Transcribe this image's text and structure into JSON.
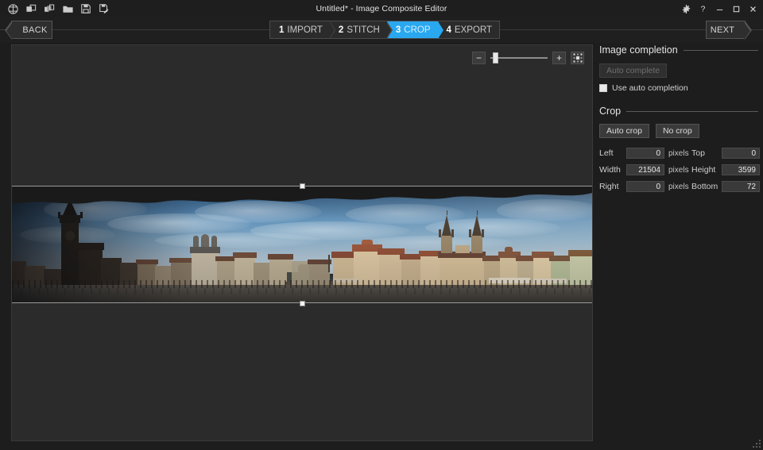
{
  "titlebar": {
    "title": "Untitled* - Image Composite Editor",
    "tools": [
      {
        "name": "new-panorama-icon",
        "label": "New panorama"
      },
      {
        "name": "new-from-images-icon",
        "label": "New panorama from images"
      },
      {
        "name": "new-from-video-icon",
        "label": "New panorama from video"
      },
      {
        "name": "open-icon",
        "label": "Open"
      },
      {
        "name": "save-icon",
        "label": "Save"
      },
      {
        "name": "save-as-icon",
        "label": "Save as"
      }
    ],
    "controls": [
      {
        "name": "settings-icon",
        "label": "Settings"
      },
      {
        "name": "help-icon",
        "label": "Help"
      },
      {
        "name": "minimize-button",
        "label": "Minimize"
      },
      {
        "name": "maximize-button",
        "label": "Maximize"
      },
      {
        "name": "close-button",
        "label": "Close"
      }
    ]
  },
  "nav": {
    "back_label": "BACK",
    "next_label": "NEXT",
    "steps": [
      {
        "num": "1",
        "label": "IMPORT",
        "active": false
      },
      {
        "num": "2",
        "label": "STITCH",
        "active": false
      },
      {
        "num": "3",
        "label": "CROP",
        "active": true
      },
      {
        "num": "4",
        "label": "EXPORT",
        "active": false
      }
    ],
    "active_color": "#29a8f0"
  },
  "zoom_toolbar": {
    "zoom_out_label": "−",
    "zoom_in_label": "+",
    "fit_label": "Fit to window",
    "slider_position_percent": 5
  },
  "panel": {
    "image_completion": {
      "heading": "Image completion",
      "auto_complete_label": "Auto complete",
      "auto_complete_enabled": false,
      "use_auto_completion_label": "Use auto completion",
      "use_auto_completion_checked": false
    },
    "crop": {
      "heading": "Crop",
      "auto_crop_label": "Auto crop",
      "no_crop_label": "No crop",
      "unit": "pixels",
      "fields": [
        {
          "label": "Left",
          "value": "0"
        },
        {
          "label": "Top",
          "value": "0"
        },
        {
          "label": "Width",
          "value": "21504"
        },
        {
          "label": "Height",
          "value": "3599"
        },
        {
          "label": "Right",
          "value": "0"
        },
        {
          "label": "Bottom",
          "value": "72"
        }
      ]
    }
  },
  "canvas": {
    "image_alt": "Panorama of Prague Old Town Square with Old Town Hall clock tower, St. Nicholas Church and Church of Our Lady before Týn",
    "crop_handle_top": "top-crop-handle",
    "crop_handle_bottom": "bottom-crop-handle"
  }
}
